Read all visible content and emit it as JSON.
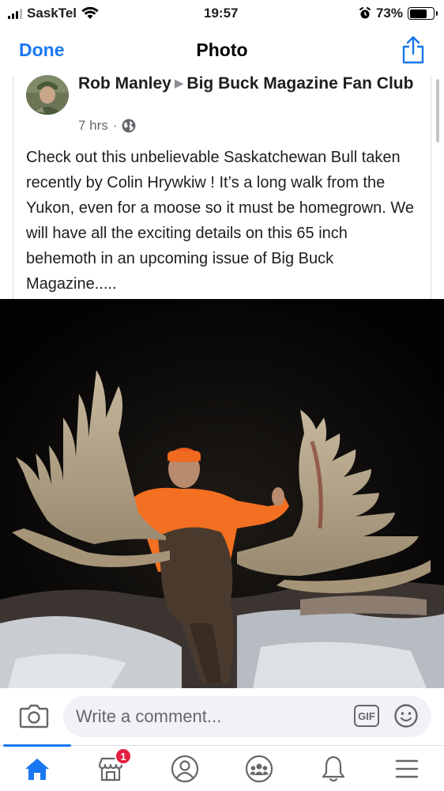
{
  "status_bar": {
    "carrier": "SaskTel",
    "time": "19:57",
    "battery_percent": "73%",
    "battery_level": 0.73
  },
  "nav": {
    "done_label": "Done",
    "title": "Photo",
    "share_icon": "share-icon"
  },
  "post": {
    "author": "Rob Manley",
    "group": "Big Buck Magazine Fan Club",
    "time_ago": "7 hrs",
    "separator": "·",
    "privacy_icon": "globe-icon",
    "text": "Check out this unbelievable Saskatchewan Bull taken recently by Colin Hrywkiw ! It’s a long walk from the Yukon, even for a moose so it must be homegrown. We will have all the exciting details on this 65 inch behemoth in an upcoming issue of Big Buck Magazine.....",
    "photo_icon": "moose-photo"
  },
  "composer": {
    "placeholder": "Write a comment...",
    "gif_label": "GIF",
    "camera_icon": "camera-icon",
    "emoji_icon": "emoji-icon"
  },
  "tabs": [
    {
      "name": "home",
      "icon": "home-icon",
      "active": true
    },
    {
      "name": "marketplace",
      "icon": "marketplace-icon",
      "badge": "1"
    },
    {
      "name": "profile",
      "icon": "profile-icon"
    },
    {
      "name": "groups",
      "icon": "groups-icon"
    },
    {
      "name": "notifications",
      "icon": "bell-icon"
    },
    {
      "name": "menu",
      "icon": "menu-icon"
    }
  ],
  "colors": {
    "accent": "#1877f2",
    "badge": "#e41e3f",
    "secondary_text": "#65676b",
    "input_bg": "#f0f2f5"
  }
}
